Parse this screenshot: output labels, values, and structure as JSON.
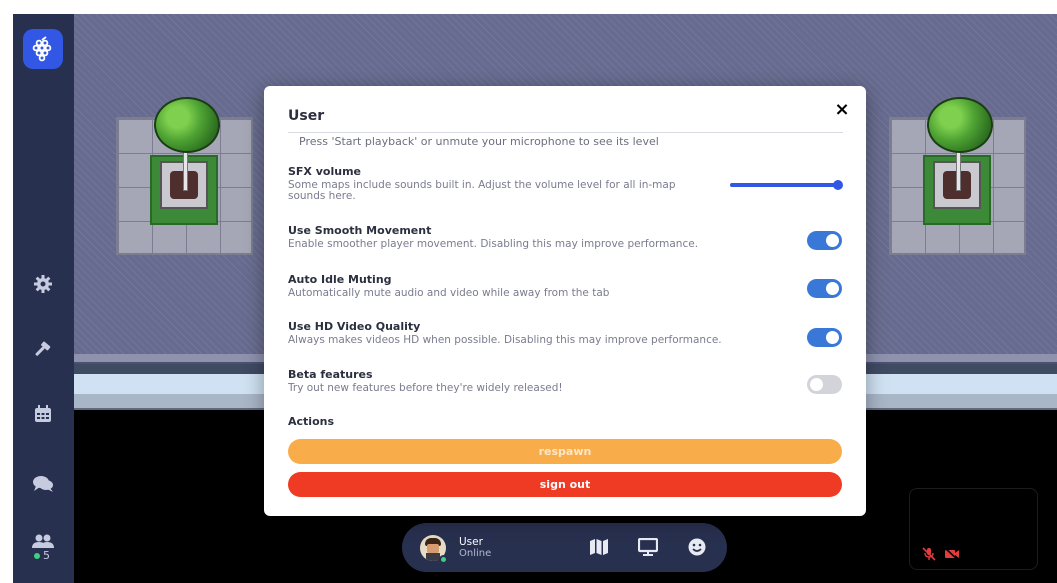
{
  "sidebar": {
    "logo_icon": "gather-grapes-logo-icon",
    "items": [
      {
        "name": "settings",
        "icon": "gear-icon"
      },
      {
        "name": "build",
        "icon": "hammer-icon"
      },
      {
        "name": "calendar",
        "icon": "calendar-icon"
      },
      {
        "name": "chat",
        "icon": "chat-bubbles-icon"
      },
      {
        "name": "participants",
        "icon": "people-icon"
      }
    ],
    "online_count": "5"
  },
  "modal": {
    "title": "User",
    "close_label": "×",
    "mic_hint": "Press 'Start playback' or unmute your microphone to see its level",
    "sfx": {
      "title": "SFX volume",
      "description": "Some maps include sounds built in. Adjust the volume level for all in-map sounds here.",
      "level": 1.0
    },
    "settings": [
      {
        "title": "Use Smooth Movement",
        "description": "Enable smoother player movement. Disabling this may improve performance.",
        "enabled": true
      },
      {
        "title": "Auto Idle Muting",
        "description": "Automatically mute audio and video while away from the tab",
        "enabled": true
      },
      {
        "title": "Use HD Video Quality",
        "description": "Always makes videos HD when possible. Disabling this may improve performance.",
        "enabled": true
      },
      {
        "title": "Beta features",
        "description": "Try out new features before they're widely released!",
        "enabled": false
      }
    ],
    "actions_label": "Actions",
    "respawn_label": "respawn",
    "signout_label": "sign out"
  },
  "bottombar": {
    "user_name": "User",
    "user_status": "Online",
    "buttons": [
      "map-icon",
      "screen-share-icon",
      "emoji-icon"
    ]
  },
  "video": {
    "mic": "muted-mic-icon",
    "camera": "camera-off-icon"
  },
  "colors": {
    "accent": "#3157e4",
    "toggle_on": "#3a78d8",
    "respawn": "#f9ad4a",
    "signout": "#ef3b24",
    "sidebar": "#28304f"
  }
}
